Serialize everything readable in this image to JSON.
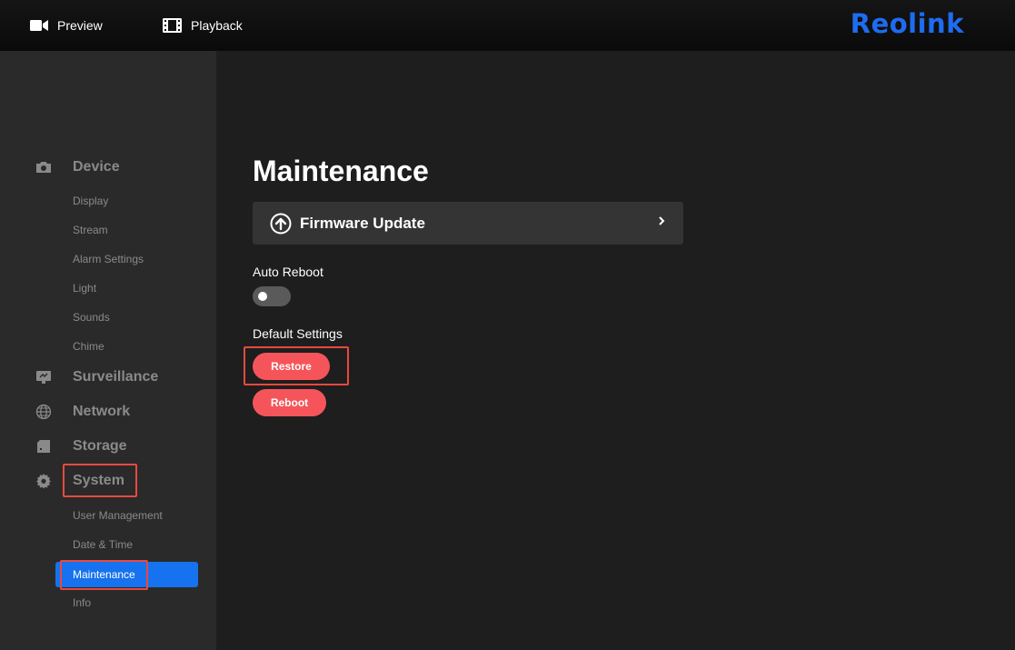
{
  "topbar": {
    "preview_label": "Preview",
    "playback_label": "Playback",
    "logo": "Reolink"
  },
  "sidebar": {
    "sections": [
      {
        "label": "Device",
        "icon": "camera-icon",
        "items": [
          "Display",
          "Stream",
          "Alarm Settings",
          "Light",
          "Sounds",
          "Chime"
        ]
      },
      {
        "label": "Surveillance",
        "icon": "monitor-icon"
      },
      {
        "label": "Network",
        "icon": "globe-icon"
      },
      {
        "label": "Storage",
        "icon": "sd-card-icon"
      },
      {
        "label": "System",
        "icon": "gear-icon",
        "items": [
          "User Management",
          "Date & Time",
          "Maintenance",
          "Info"
        ],
        "active_item": "Maintenance"
      }
    ]
  },
  "main": {
    "title": "Maintenance",
    "firmware_update_label": "Firmware Update",
    "auto_reboot_label": "Auto Reboot",
    "auto_reboot_enabled": false,
    "default_settings_label": "Default Settings",
    "restore_label": "Restore",
    "reboot_label": "Reboot"
  },
  "colors": {
    "accent": "#1672ee",
    "button": "#f5555a",
    "highlight_box": "#e8493f",
    "logo": "#1e6cf0"
  }
}
